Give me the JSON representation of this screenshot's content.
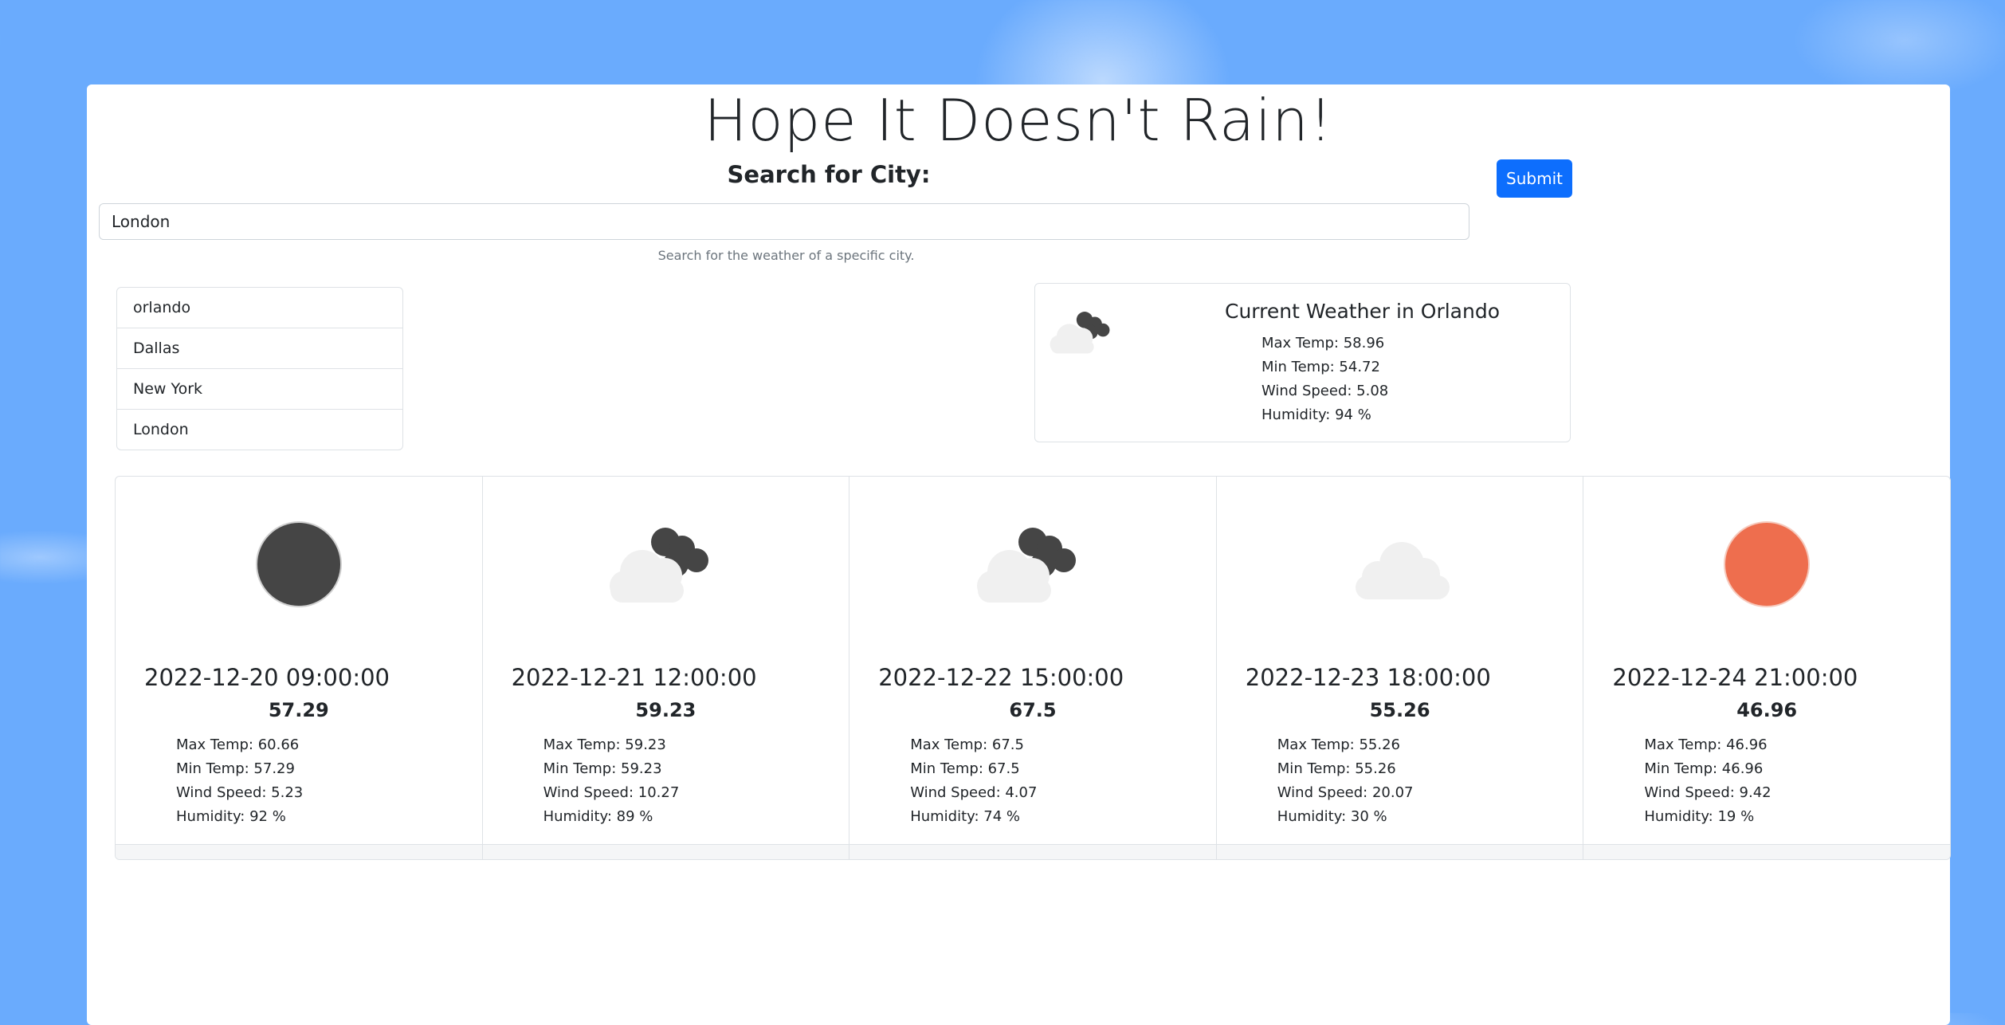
{
  "app": {
    "title": "Hope It Doesn't Rain!"
  },
  "search": {
    "label": "Search for City:",
    "value": "London",
    "help": "Search for the weather of a specific city.",
    "submit_label": "Submit"
  },
  "history": [
    "orlando",
    "Dallas",
    "New York",
    "London"
  ],
  "current": {
    "title": "Current Weather in Orlando",
    "icon": "cloudy-night-icon",
    "max_temp": "Max Temp: 58.96",
    "min_temp": "Min Temp: 54.72",
    "wind": "Wind Speed: 5.08",
    "humidity": "Humidity: 94 %"
  },
  "forecast": [
    {
      "date": "2022-12-20 09:00:00",
      "temp": "57.29",
      "icon": "moon-icon",
      "max_temp": "Max Temp: 60.66",
      "min_temp": "Min Temp: 57.29",
      "wind": "Wind Speed: 5.23",
      "humidity": "Humidity: 92 %"
    },
    {
      "date": "2022-12-21 12:00:00",
      "temp": "59.23",
      "icon": "cloudy-night-icon",
      "max_temp": "Max Temp: 59.23",
      "min_temp": "Min Temp: 59.23",
      "wind": "Wind Speed: 10.27",
      "humidity": "Humidity: 89 %"
    },
    {
      "date": "2022-12-22 15:00:00",
      "temp": "67.5",
      "icon": "cloudy-night-icon",
      "max_temp": "Max Temp: 67.5",
      "min_temp": "Min Temp: 67.5",
      "wind": "Wind Speed: 4.07",
      "humidity": "Humidity: 74 %"
    },
    {
      "date": "2022-12-23 18:00:00",
      "temp": "55.26",
      "icon": "cloud-icon",
      "max_temp": "Max Temp: 55.26",
      "min_temp": "Min Temp: 55.26",
      "wind": "Wind Speed: 20.07",
      "humidity": "Humidity: 30 %"
    },
    {
      "date": "2022-12-24 21:00:00",
      "temp": "46.96",
      "icon": "sun-icon",
      "max_temp": "Max Temp: 46.96",
      "min_temp": "Min Temp: 46.96",
      "wind": "Wind Speed: 9.42",
      "humidity": "Humidity: 19 %"
    }
  ],
  "colors": {
    "accent": "#0d6efd",
    "background": "#6aabfd",
    "sun": "#ee6e4e",
    "moon": "#444444"
  }
}
